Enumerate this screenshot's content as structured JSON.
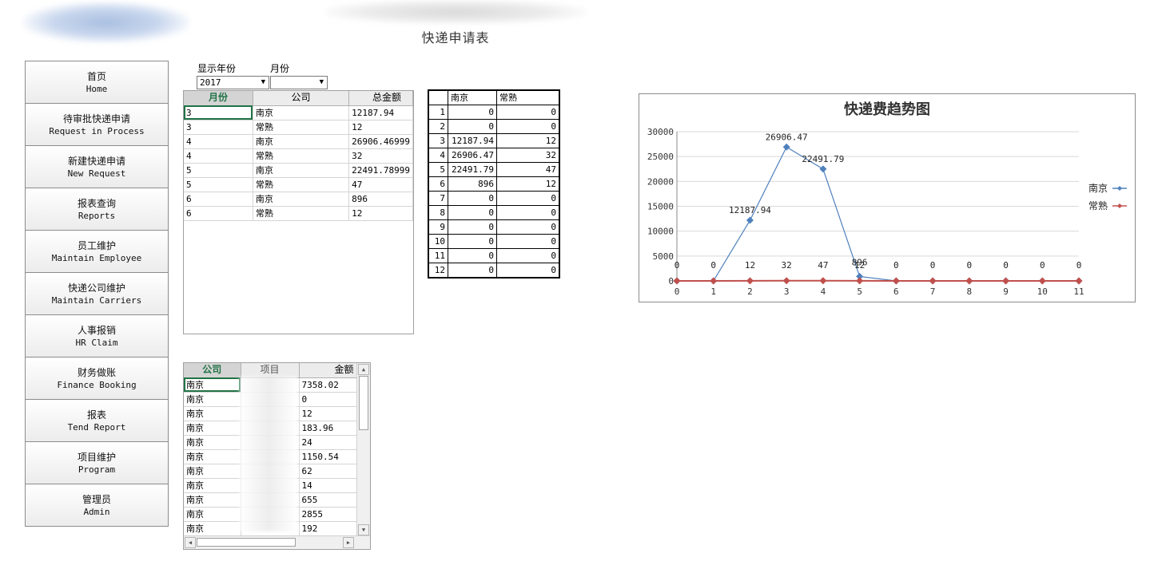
{
  "header": {
    "title": "快递申请表"
  },
  "sidebar": {
    "items": [
      {
        "zh": "首页",
        "en": "Home"
      },
      {
        "zh": "待审批快递申请",
        "en": "Request in Process"
      },
      {
        "zh": "新建快递申请",
        "en": "New Request"
      },
      {
        "zh": "报表查询",
        "en": "Reports"
      },
      {
        "zh": "员工维护",
        "en": "Maintain Employee"
      },
      {
        "zh": "快递公司维护",
        "en": "Maintain Carriers"
      },
      {
        "zh": "人事报销",
        "en": "HR Claim"
      },
      {
        "zh": "财务做账",
        "en": "Finance Booking"
      },
      {
        "zh": "报表",
        "en": "Tend Report"
      },
      {
        "zh": "项目维护",
        "en": "Program"
      },
      {
        "zh": "管理员",
        "en": "Admin"
      }
    ]
  },
  "filters": {
    "year_label": "显示年份",
    "month_label": "月份",
    "year_value": "2017",
    "month_value": ""
  },
  "summary_grid": {
    "headers": [
      "月份",
      "公司",
      "总金额"
    ],
    "rows": [
      [
        "3",
        "南京",
        "12187.94"
      ],
      [
        "3",
        "常熟",
        "12"
      ],
      [
        "4",
        "南京",
        "26906.46999"
      ],
      [
        "4",
        "常熟",
        "32"
      ],
      [
        "5",
        "南京",
        "22491.78999"
      ],
      [
        "5",
        "常熟",
        "47"
      ],
      [
        "6",
        "南京",
        "896"
      ],
      [
        "6",
        "常熟",
        "12"
      ]
    ]
  },
  "month_table": {
    "headers": [
      "",
      "南京",
      "常熟"
    ],
    "rows": [
      [
        "1",
        "0",
        "0"
      ],
      [
        "2",
        "0",
        "0"
      ],
      [
        "3",
        "12187.94",
        "12"
      ],
      [
        "4",
        "26906.47",
        "32"
      ],
      [
        "5",
        "22491.79",
        "47"
      ],
      [
        "6",
        "896",
        "12"
      ],
      [
        "7",
        "0",
        "0"
      ],
      [
        "8",
        "0",
        "0"
      ],
      [
        "9",
        "0",
        "0"
      ],
      [
        "10",
        "0",
        "0"
      ],
      [
        "11",
        "0",
        "0"
      ],
      [
        "12",
        "0",
        "0"
      ]
    ]
  },
  "detail_grid": {
    "headers": [
      "公司",
      "项目",
      "金额"
    ],
    "rows": [
      [
        "南京",
        "",
        "7358.02"
      ],
      [
        "南京",
        "",
        "0"
      ],
      [
        "南京",
        "",
        "12"
      ],
      [
        "南京",
        "",
        "183.96"
      ],
      [
        "南京",
        "",
        "24"
      ],
      [
        "南京",
        "",
        "1150.54"
      ],
      [
        "南京",
        "",
        "62"
      ],
      [
        "南京",
        "",
        "14"
      ],
      [
        "南京",
        "",
        "655"
      ],
      [
        "南京",
        "",
        "2855"
      ],
      [
        "南京",
        "",
        "192"
      ]
    ]
  },
  "chart_data": {
    "type": "line",
    "title": "快递费趋势图",
    "x": [
      0,
      1,
      2,
      3,
      4,
      5,
      6,
      7,
      8,
      9,
      10,
      11
    ],
    "ylim": [
      0,
      30000
    ],
    "yticks": [
      0,
      5000,
      10000,
      15000,
      20000,
      25000,
      30000
    ],
    "grid": true,
    "legend_position": "right",
    "series": [
      {
        "name": "南京",
        "color": "#4f81bd",
        "values": [
          0,
          0,
          12187.94,
          26906.47,
          22491.79,
          896,
          0,
          0,
          0,
          0,
          0,
          0
        ],
        "labels": [
          "",
          "",
          "12187.94",
          "26906.47",
          "22491.79",
          "896",
          "",
          "",
          "",
          "",
          "",
          ""
        ]
      },
      {
        "name": "常熟",
        "color": "#c0504d",
        "values": [
          0,
          0,
          12,
          32,
          47,
          12,
          0,
          0,
          0,
          0,
          0,
          0
        ],
        "labels": [
          "0",
          "0",
          "12",
          "32",
          "47",
          "12",
          "0",
          "0",
          "0",
          "0",
          "0",
          "0"
        ]
      }
    ]
  }
}
